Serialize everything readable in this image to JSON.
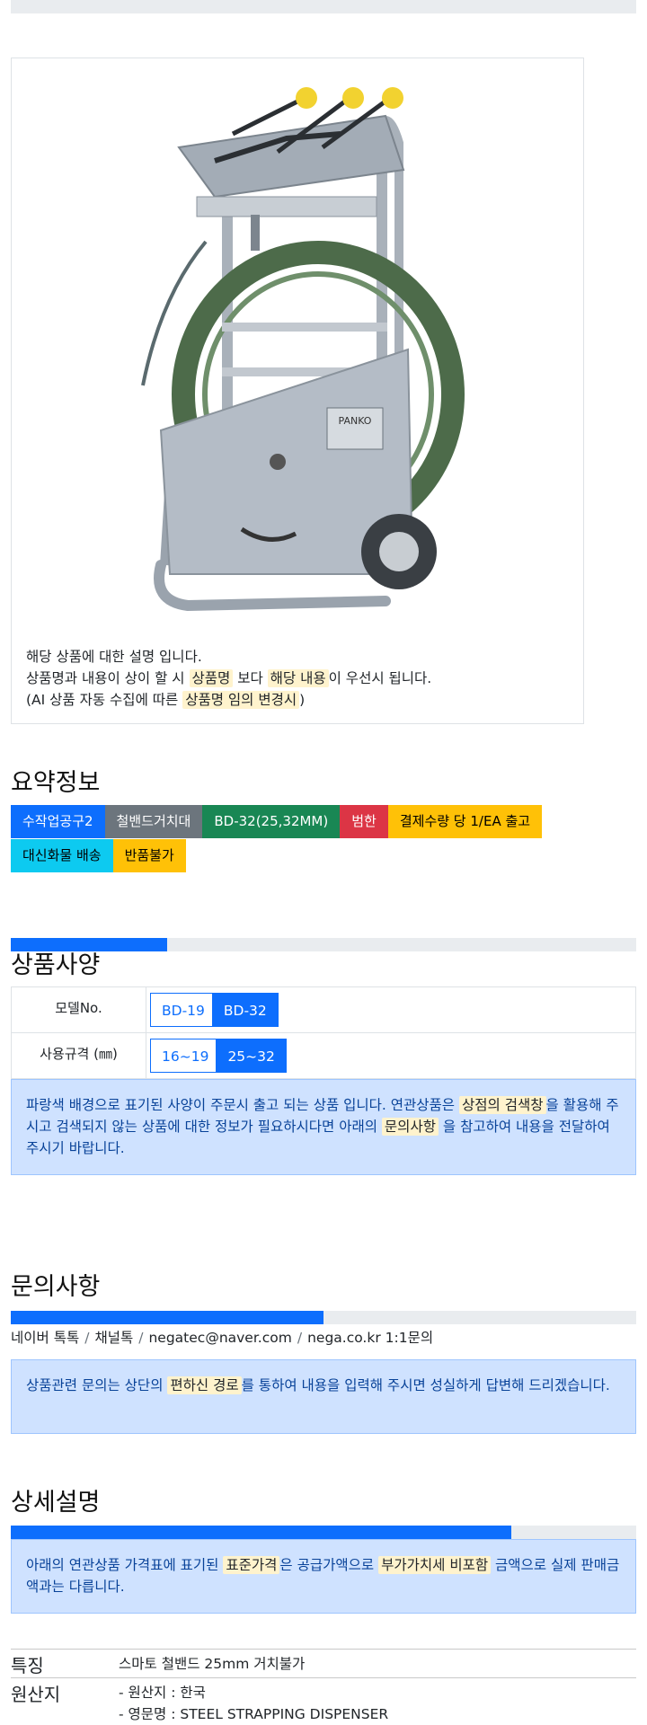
{
  "image_notice": {
    "line1": "해당 상품에 대한 설명 입니다.",
    "line2_a": "상품명과 내용이 상이 할 시 ",
    "line2_hl1": "상품명",
    "line2_b": " 보다 ",
    "line2_hl2": "해당 내용",
    "line2_c": "이 우선시 됩니다.",
    "line3_a": "(AI 상품 자동 수집에 따른 ",
    "line3_hl": "상품명 임의 변경시",
    "line3_b": ")",
    "brand_plate": "PANKO"
  },
  "summary": {
    "title": "요약정보",
    "badges": [
      {
        "label": "수작업공구2",
        "bg": "#0d6efd",
        "fg": "#ffffff"
      },
      {
        "label": "철밴드거치대",
        "bg": "#6c757d",
        "fg": "#ffffff"
      },
      {
        "label": "BD-32(25,32MM)",
        "bg": "#198754",
        "fg": "#ffffff"
      },
      {
        "label": "범한",
        "bg": "#dc3545",
        "fg": "#ffffff"
      },
      {
        "label": "결제수량 당 1/EA 출고",
        "bg": "#ffc107",
        "fg": "#000000"
      },
      {
        "label": "대신화물 배송",
        "bg": "#0dcaf0",
        "fg": "#000000"
      },
      {
        "label": "반품불가",
        "bg": "#ffc107",
        "fg": "#000000"
      }
    ]
  },
  "spec": {
    "title": "상품사양",
    "rows": [
      {
        "label": "모델No.",
        "options": [
          "BD-19",
          "BD-32"
        ],
        "selected": "BD-32"
      },
      {
        "label": "사용규격 (㎜)",
        "options": [
          "16~19",
          "25~32"
        ],
        "selected": "25~32"
      }
    ],
    "notice_a": "파랑색 배경으로 표기된 사양이 주문시 출고 되는 상품 입니다. 연관상품은 ",
    "notice_hl1": "상점의 검색창",
    "notice_b": "을 활용해 주시고 검색되지 않는 상품에 대한 정보가 필요하시다면 아래의 ",
    "notice_hl2": "문의사항",
    "notice_c": " 을 참고하여 내용을 전달하여 주시기 바랍니다."
  },
  "inquiry": {
    "title": "문의사항",
    "contacts": [
      "네이버 톡톡",
      "채널톡",
      "negatec@naver.com",
      "nega.co.kr 1:1문의"
    ],
    "notice_a": "상품관련 문의는 상단의 ",
    "notice_hl": "편하신 경로",
    "notice_b": "를 통하여 내용을 입력해 주시면 성실하게 답변해 드리겠습니다."
  },
  "detail": {
    "title": "상세설명",
    "notice_a": "아래의 연관상품 가격표에 표기된 ",
    "notice_hl1": "표준가격",
    "notice_b": "은 공급가액으로 ",
    "notice_hl2": "부가가치세 비포함",
    "notice_c": " 금액으로 실제 판매금액과는 다릅니다.",
    "features_key": "특징",
    "features_value": "스마토 철밴드 25mm 거치불가",
    "origin_key": "원산지",
    "origin_line1": "- 원산지 : 한국",
    "origin_line2": "- 영문명 : STEEL STRAPPING DISPENSER"
  },
  "progress": {
    "spec": 0.25,
    "inquiry": 0.5,
    "detail": 0.8
  }
}
